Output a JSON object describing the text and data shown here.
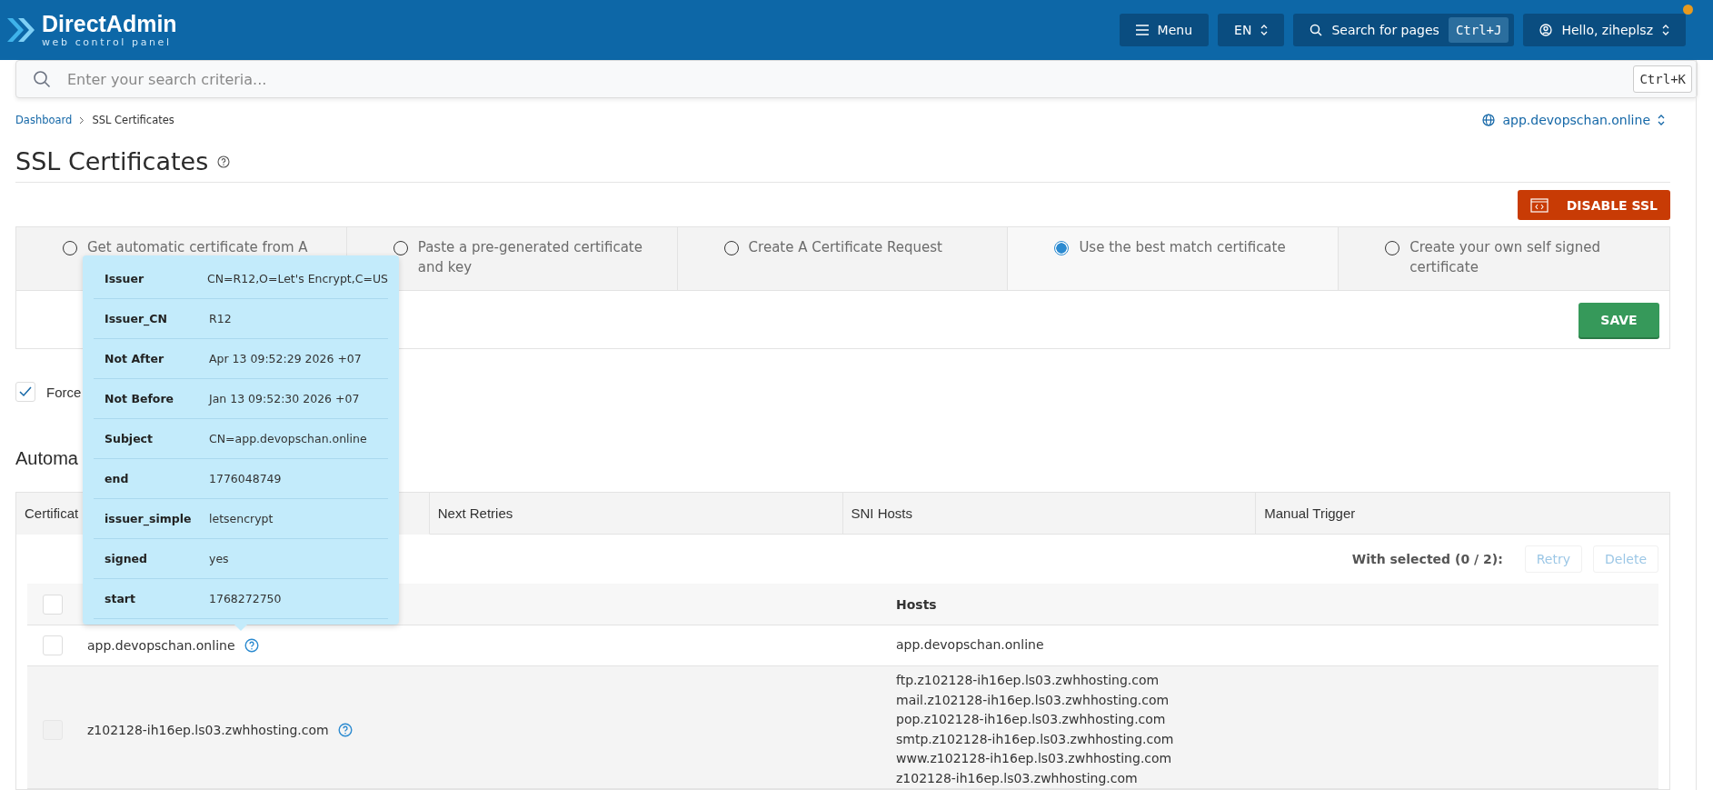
{
  "header": {
    "logo_title": "DirectAdmin",
    "logo_subtitle": "web control panel",
    "menu_button": "Menu",
    "language": "EN",
    "search_button": "Search for pages",
    "search_shortcut": "Ctrl+J",
    "user_button": "Hello, ziheplsz",
    "has_notification": true
  },
  "search": {
    "placeholder": "Enter your search criteria...",
    "shortcut": "Ctrl+K"
  },
  "breadcrumb": [
    "Dashboard",
    "SSL Certificates"
  ],
  "domain": "app.devopschan.online",
  "page_title": "SSL Certificates",
  "disable_button": "DISABLE SSL",
  "options": [
    {
      "label": "Get automatic certificate from A",
      "selected": false
    },
    {
      "label": "Paste a pre-generated certificate and key",
      "selected": false
    },
    {
      "label": "Create A Certificate Request",
      "selected": false
    },
    {
      "label": "Use the best match certificate",
      "selected": true
    },
    {
      "label": "Create your own self signed certificate",
      "selected": false
    }
  ],
  "save_button": "SAVE",
  "force_checkbox": {
    "label": "Force",
    "checked": true
  },
  "section_title": "Automa",
  "tabs": [
    {
      "label": "Certificat",
      "selected": true
    },
    {
      "label": "Next Retries",
      "selected": false
    },
    {
      "label": "SNI Hosts",
      "selected": false
    },
    {
      "label": "Manual Trigger",
      "selected": false
    }
  ],
  "bulk": {
    "label": "With selected (0 / 2):",
    "actions": [
      {
        "label": "Retry",
        "disabled": true
      },
      {
        "label": "Delete",
        "disabled": true
      }
    ]
  },
  "table": {
    "select_all": {
      "checked": false
    },
    "columns": [
      "Hosts"
    ],
    "rows": [
      {
        "name": "app.devopschan.online",
        "disabled": false,
        "hosts": [
          "app.devopschan.online"
        ]
      },
      {
        "name": "z102128-ih16ep.ls03.zwhhosting.com",
        "disabled": true,
        "hosts": [
          "ftp.z102128-ih16ep.ls03.zwhhosting.com",
          "mail.z102128-ih16ep.ls03.zwhhosting.com",
          "pop.z102128-ih16ep.ls03.zwhhosting.com",
          "smtp.z102128-ih16ep.ls03.zwhhosting.com",
          "www.z102128-ih16ep.ls03.zwhhosting.com",
          "z102128-ih16ep.ls03.zwhhosting.com"
        ]
      }
    ]
  },
  "tooltip": {
    "rows": [
      {
        "key": "Issuer",
        "value": "CN=R12,O=Let's Encrypt,C=US"
      },
      {
        "key": "Issuer_CN",
        "value": "R12"
      },
      {
        "key": "Not After",
        "value": "Apr 13 09:52:29 2026 +07"
      },
      {
        "key": "Not Before",
        "value": "Jan 13 09:52:30 2026 +07"
      },
      {
        "key": "Subject",
        "value": "CN=app.devopschan.online"
      },
      {
        "key": "end",
        "value": "1776048749"
      },
      {
        "key": "issuer_simple",
        "value": "letsencrypt"
      },
      {
        "key": "signed",
        "value": "yes"
      },
      {
        "key": "start",
        "value": "1768272750"
      }
    ]
  }
}
